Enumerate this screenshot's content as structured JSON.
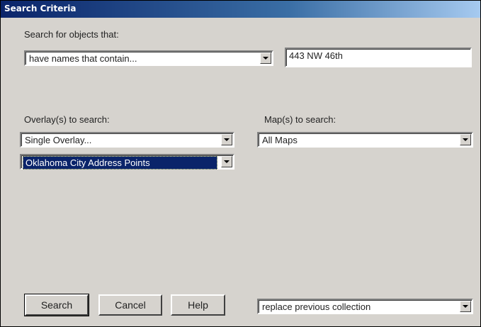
{
  "window": {
    "title": "Search Criteria"
  },
  "criteria": {
    "label": "Search for objects that:",
    "condition": "have names that contain...",
    "search_text": "443 NW 46th"
  },
  "overlay": {
    "label": "Overlay(s) to search:",
    "mode": "Single Overlay...",
    "selected": "Oklahoma City Address Points"
  },
  "maps": {
    "label": "Map(s) to search:",
    "selected": "All Maps"
  },
  "buttons": {
    "search": "Search",
    "cancel": "Cancel",
    "help": "Help"
  },
  "collection": {
    "mode": "replace previous collection"
  },
  "icons": {
    "dropdown": "chevron-down-icon"
  }
}
